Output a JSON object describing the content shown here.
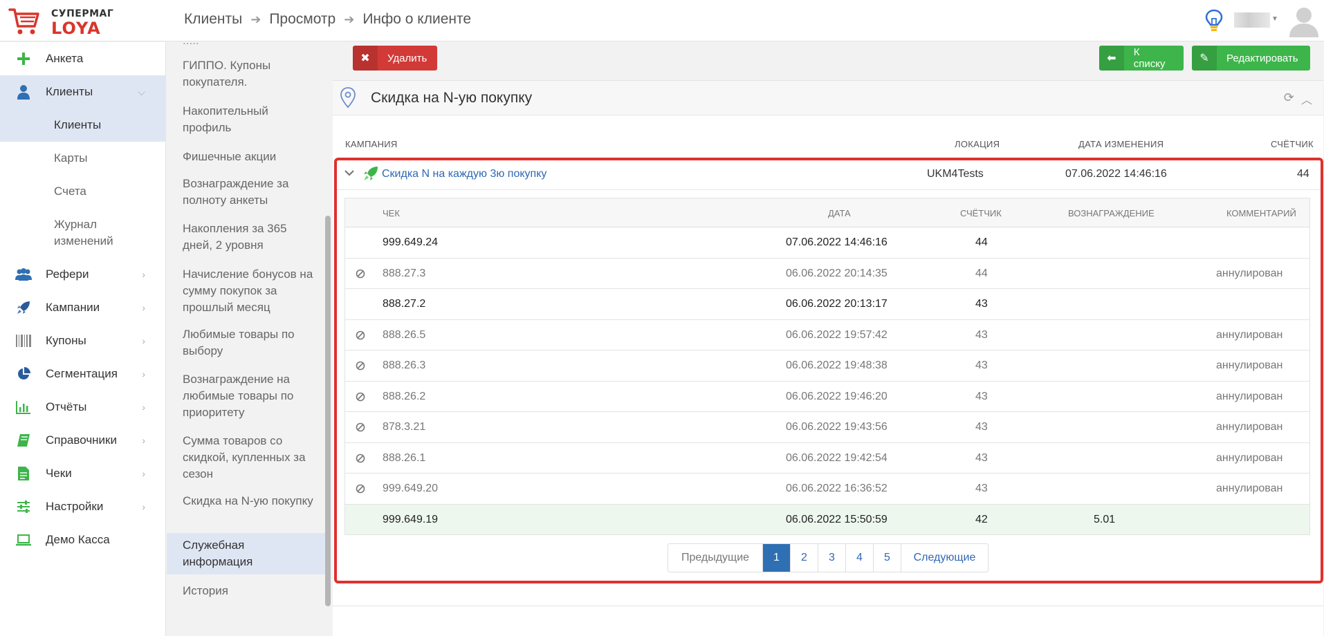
{
  "header": {
    "brand_top": "СУПЕРМАГ",
    "brand_bottom": "LOYA",
    "breadcrumb": [
      "Клиенты",
      "Просмотр",
      "Инфо о клиенте"
    ],
    "accent": "#d9362b"
  },
  "sidebar": {
    "items": [
      {
        "label": "Анкета",
        "icon": "plus-icon"
      },
      {
        "label": "Клиенты",
        "icon": "user-icon"
      },
      {
        "label": "Рефери",
        "icon": "users-icon"
      },
      {
        "label": "Кампании",
        "icon": "rocket-icon"
      },
      {
        "label": "Купоны",
        "icon": "barcode-icon"
      },
      {
        "label": "Сегментация",
        "icon": "pie-chart-icon"
      },
      {
        "label": "Отчёты",
        "icon": "bar-chart-icon"
      },
      {
        "label": "Справочники",
        "icon": "book-icon"
      },
      {
        "label": "Чеки",
        "icon": "receipt-icon"
      },
      {
        "label": "Настройки",
        "icon": "sliders-icon"
      },
      {
        "label": "Демо Касса",
        "icon": "laptop-icon"
      }
    ],
    "sub_items": [
      "Клиенты",
      "Карты",
      "Счета",
      "Журнал изменений"
    ]
  },
  "menu2": {
    "items": [
      "ГИППО. Купоны покупателя.",
      "Накопительный профиль",
      "Фишечные акции",
      "Вознаграждение за полноту анкеты",
      "Накопления за 365 дней, 2 уровня",
      "Начисление бонусов на сумму покупок за прошлый месяц",
      "Любимые товары по выбору",
      "Вознаграждение на любимые товары по приоритету",
      "Сумма товаров со скидкой, купленных за сезон",
      "Скидка на N-ую покупку",
      "Служебная информация",
      "История"
    ]
  },
  "toolbar": {
    "delete_label": "Удалить",
    "back_label": "К списку",
    "edit_label": "Редактировать"
  },
  "panel": {
    "title": "Скидка на N-ую покупку",
    "columns": {
      "campaign": "Кампания",
      "location": "Локация",
      "changed": "Дата изменения",
      "counter": "Счётчик"
    },
    "campaign": {
      "name": "Скидка N на каждую 3ю покупку",
      "location": "UKM4Tests",
      "changed": "07.06.2022 14:46:16",
      "counter": "44"
    },
    "sub_columns": {
      "check": "Чек",
      "date": "Дата",
      "counter": "Счётчик",
      "reward": "Вознаграждение",
      "comment": "Комментарий"
    },
    "rows": [
      {
        "check": "999.649.24",
        "date": "07.06.2022 14:46:16",
        "counter": "44",
        "reward": "",
        "comment": "",
        "state": "normal"
      },
      {
        "check": "888.27.3",
        "date": "06.06.2022 20:14:35",
        "counter": "44",
        "reward": "",
        "comment": "аннулирован",
        "state": "annul"
      },
      {
        "check": "888.27.2",
        "date": "06.06.2022 20:13:17",
        "counter": "43",
        "reward": "",
        "comment": "",
        "state": "normal"
      },
      {
        "check": "888.26.5",
        "date": "06.06.2022 19:57:42",
        "counter": "43",
        "reward": "",
        "comment": "аннулирован",
        "state": "annul"
      },
      {
        "check": "888.26.3",
        "date": "06.06.2022 19:48:38",
        "counter": "43",
        "reward": "",
        "comment": "аннулирован",
        "state": "annul"
      },
      {
        "check": "888.26.2",
        "date": "06.06.2022 19:46:20",
        "counter": "43",
        "reward": "",
        "comment": "аннулирован",
        "state": "annul"
      },
      {
        "check": "878.3.21",
        "date": "06.06.2022 19:43:56",
        "counter": "43",
        "reward": "",
        "comment": "аннулирован",
        "state": "annul"
      },
      {
        "check": "888.26.1",
        "date": "06.06.2022 19:42:54",
        "counter": "43",
        "reward": "",
        "comment": "аннулирован",
        "state": "annul"
      },
      {
        "check": "999.649.20",
        "date": "06.06.2022 16:36:52",
        "counter": "43",
        "reward": "",
        "comment": "аннулирован",
        "state": "annul"
      },
      {
        "check": "999.649.19",
        "date": "06.06.2022 15:50:59",
        "counter": "42",
        "reward": "5.01",
        "comment": "",
        "state": "reward"
      }
    ],
    "pager": {
      "prev": "Предыдущие",
      "pages": [
        "1",
        "2",
        "3",
        "4",
        "5"
      ],
      "current": "1",
      "next": "Следующие"
    }
  }
}
